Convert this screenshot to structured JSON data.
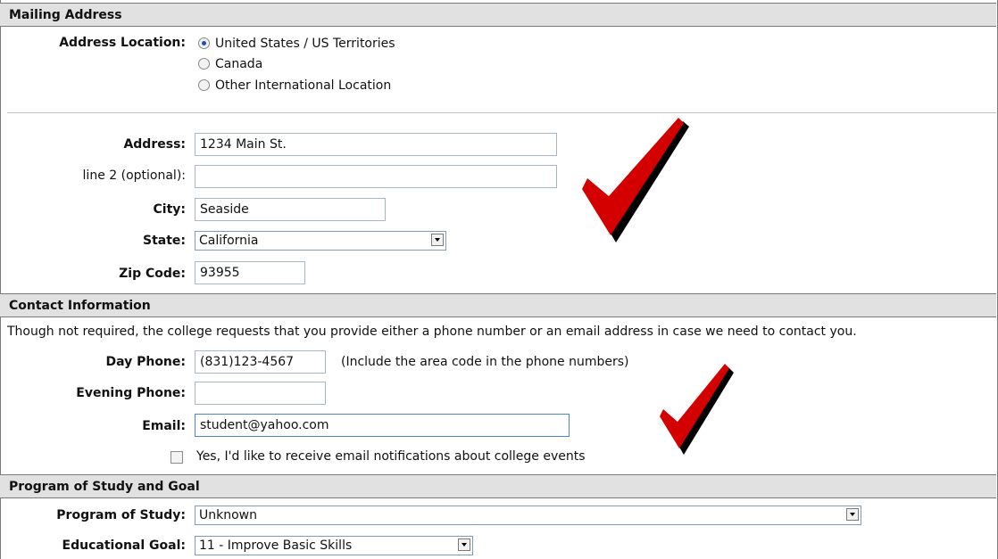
{
  "mailing": {
    "header": "Mailing Address",
    "address_location_label": "Address Location:",
    "location_options": [
      "United States / US Territories",
      "Canada",
      "Other International Location"
    ],
    "address_label": "Address:",
    "address_value": "1234 Main St.",
    "line2_label": "line 2 (optional):",
    "line2_value": "",
    "city_label": "City:",
    "city_value": "Seaside",
    "state_label": "State:",
    "state_value": "California",
    "zip_label": "Zip Code:",
    "zip_value": "93955"
  },
  "contact": {
    "header": "Contact Information",
    "note": "Though not required, the college requests that you provide either a phone number or an email address in case we need to contact you.",
    "day_phone_label": "Day Phone:",
    "day_phone_value": "(831)123-4567",
    "phone_hint": "(Include the area code in the phone numbers)",
    "evening_phone_label": "Evening Phone:",
    "evening_phone_value": "",
    "email_label": "Email:",
    "email_value": "student@yahoo.com",
    "notify_label": "Yes, I'd like to receive email notifications about college events"
  },
  "program": {
    "header": "Program of Study and Goal",
    "program_label": "Program of Study:",
    "program_value": "Unknown",
    "goal_label": "Educational Goal:",
    "goal_value": "11 - Improve Basic Skills"
  },
  "colors": {
    "header_bg": "#e1e1e1",
    "check_red": "#d40000"
  }
}
